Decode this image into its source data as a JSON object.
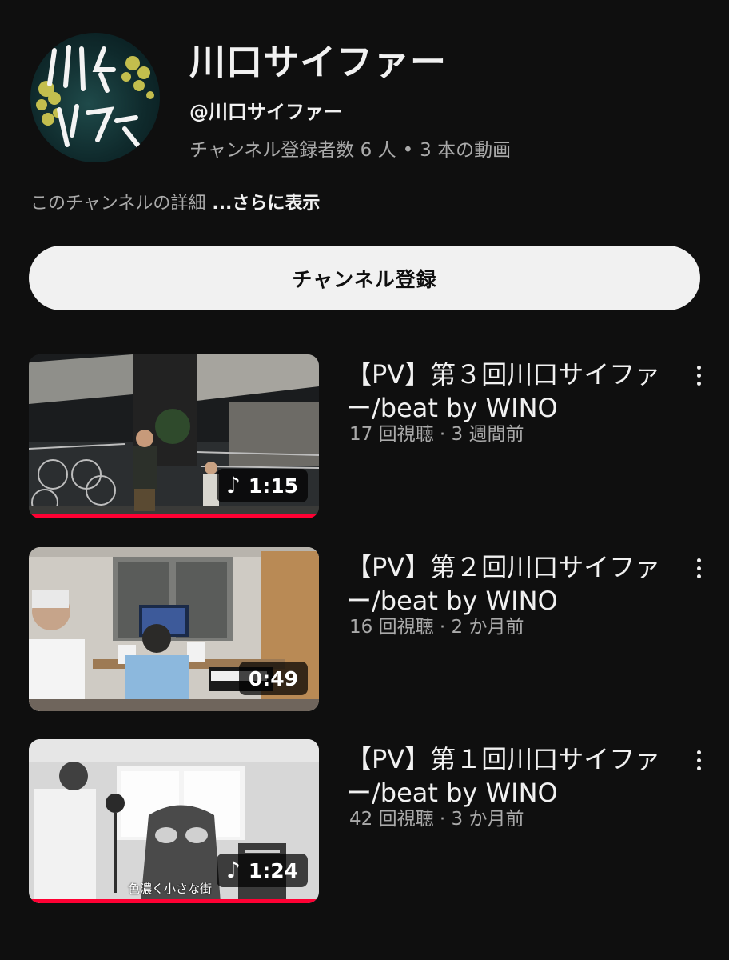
{
  "channel": {
    "title": "川口サイファー",
    "handle": "@川口サイファー",
    "subscribers": "チャンネル登録者数 6 人",
    "separator": "•",
    "video_count": "3 本の動画",
    "description": "このチャンネルの詳細",
    "more_label": "...さらに表示",
    "subscribe_label": "チャンネル登録",
    "avatar_text": "川口サイファー"
  },
  "videos": [
    {
      "title": "【PV】第３回川口サイファー/beat by WINO",
      "meta": "17 回視聴 · 3 週間前",
      "duration": "1:15",
      "has_music_icon": true,
      "progress": 1.0
    },
    {
      "title": "【PV】第２回川口サイファー/beat by WINO",
      "meta": "16 回視聴 · 2 か月前",
      "duration": "0:49",
      "has_music_icon": false,
      "progress": 0.0
    },
    {
      "title": "【PV】第１回川口サイファー/beat by WINO",
      "meta": "42 回視聴 · 3 か月前",
      "duration": "1:24",
      "has_music_icon": true,
      "progress": 1.0,
      "caption": "色濃く小さな街"
    }
  ],
  "icons": {
    "music": "music-note-icon",
    "more": "more-vert-icon"
  },
  "colors": {
    "background": "#0f0f0f",
    "progress": "#ff0033",
    "subscribe_bg": "#f1f1f1",
    "secondary_text": "#aaaaaa"
  }
}
